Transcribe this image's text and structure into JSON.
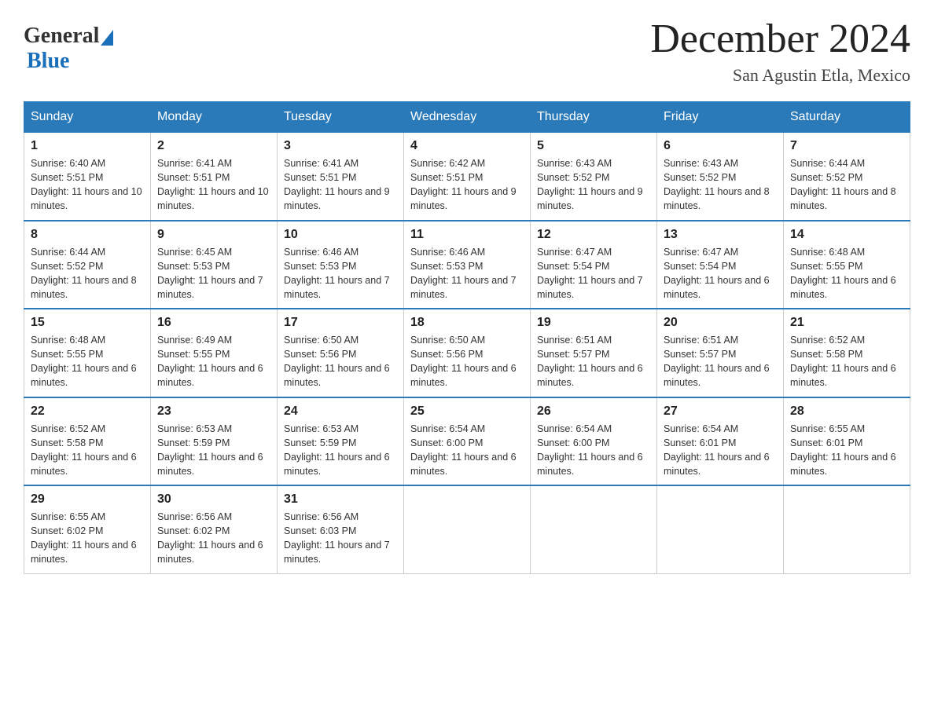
{
  "header": {
    "logo_general": "General",
    "logo_blue": "Blue",
    "month_title": "December 2024",
    "location": "San Agustin Etla, Mexico"
  },
  "days_of_week": [
    "Sunday",
    "Monday",
    "Tuesday",
    "Wednesday",
    "Thursday",
    "Friday",
    "Saturday"
  ],
  "weeks": [
    [
      {
        "day": "1",
        "sunrise": "6:40 AM",
        "sunset": "5:51 PM",
        "daylight": "11 hours and 10 minutes."
      },
      {
        "day": "2",
        "sunrise": "6:41 AM",
        "sunset": "5:51 PM",
        "daylight": "11 hours and 10 minutes."
      },
      {
        "day": "3",
        "sunrise": "6:41 AM",
        "sunset": "5:51 PM",
        "daylight": "11 hours and 9 minutes."
      },
      {
        "day": "4",
        "sunrise": "6:42 AM",
        "sunset": "5:51 PM",
        "daylight": "11 hours and 9 minutes."
      },
      {
        "day": "5",
        "sunrise": "6:43 AM",
        "sunset": "5:52 PM",
        "daylight": "11 hours and 9 minutes."
      },
      {
        "day": "6",
        "sunrise": "6:43 AM",
        "sunset": "5:52 PM",
        "daylight": "11 hours and 8 minutes."
      },
      {
        "day": "7",
        "sunrise": "6:44 AM",
        "sunset": "5:52 PM",
        "daylight": "11 hours and 8 minutes."
      }
    ],
    [
      {
        "day": "8",
        "sunrise": "6:44 AM",
        "sunset": "5:52 PM",
        "daylight": "11 hours and 8 minutes."
      },
      {
        "day": "9",
        "sunrise": "6:45 AM",
        "sunset": "5:53 PM",
        "daylight": "11 hours and 7 minutes."
      },
      {
        "day": "10",
        "sunrise": "6:46 AM",
        "sunset": "5:53 PM",
        "daylight": "11 hours and 7 minutes."
      },
      {
        "day": "11",
        "sunrise": "6:46 AM",
        "sunset": "5:53 PM",
        "daylight": "11 hours and 7 minutes."
      },
      {
        "day": "12",
        "sunrise": "6:47 AM",
        "sunset": "5:54 PM",
        "daylight": "11 hours and 7 minutes."
      },
      {
        "day": "13",
        "sunrise": "6:47 AM",
        "sunset": "5:54 PM",
        "daylight": "11 hours and 6 minutes."
      },
      {
        "day": "14",
        "sunrise": "6:48 AM",
        "sunset": "5:55 PM",
        "daylight": "11 hours and 6 minutes."
      }
    ],
    [
      {
        "day": "15",
        "sunrise": "6:48 AM",
        "sunset": "5:55 PM",
        "daylight": "11 hours and 6 minutes."
      },
      {
        "day": "16",
        "sunrise": "6:49 AM",
        "sunset": "5:55 PM",
        "daylight": "11 hours and 6 minutes."
      },
      {
        "day": "17",
        "sunrise": "6:50 AM",
        "sunset": "5:56 PM",
        "daylight": "11 hours and 6 minutes."
      },
      {
        "day": "18",
        "sunrise": "6:50 AM",
        "sunset": "5:56 PM",
        "daylight": "11 hours and 6 minutes."
      },
      {
        "day": "19",
        "sunrise": "6:51 AM",
        "sunset": "5:57 PM",
        "daylight": "11 hours and 6 minutes."
      },
      {
        "day": "20",
        "sunrise": "6:51 AM",
        "sunset": "5:57 PM",
        "daylight": "11 hours and 6 minutes."
      },
      {
        "day": "21",
        "sunrise": "6:52 AM",
        "sunset": "5:58 PM",
        "daylight": "11 hours and 6 minutes."
      }
    ],
    [
      {
        "day": "22",
        "sunrise": "6:52 AM",
        "sunset": "5:58 PM",
        "daylight": "11 hours and 6 minutes."
      },
      {
        "day": "23",
        "sunrise": "6:53 AM",
        "sunset": "5:59 PM",
        "daylight": "11 hours and 6 minutes."
      },
      {
        "day": "24",
        "sunrise": "6:53 AM",
        "sunset": "5:59 PM",
        "daylight": "11 hours and 6 minutes."
      },
      {
        "day": "25",
        "sunrise": "6:54 AM",
        "sunset": "6:00 PM",
        "daylight": "11 hours and 6 minutes."
      },
      {
        "day": "26",
        "sunrise": "6:54 AM",
        "sunset": "6:00 PM",
        "daylight": "11 hours and 6 minutes."
      },
      {
        "day": "27",
        "sunrise": "6:54 AM",
        "sunset": "6:01 PM",
        "daylight": "11 hours and 6 minutes."
      },
      {
        "day": "28",
        "sunrise": "6:55 AM",
        "sunset": "6:01 PM",
        "daylight": "11 hours and 6 minutes."
      }
    ],
    [
      {
        "day": "29",
        "sunrise": "6:55 AM",
        "sunset": "6:02 PM",
        "daylight": "11 hours and 6 minutes."
      },
      {
        "day": "30",
        "sunrise": "6:56 AM",
        "sunset": "6:02 PM",
        "daylight": "11 hours and 6 minutes."
      },
      {
        "day": "31",
        "sunrise": "6:56 AM",
        "sunset": "6:03 PM",
        "daylight": "11 hours and 7 minutes."
      },
      null,
      null,
      null,
      null
    ]
  ],
  "labels": {
    "sunrise_prefix": "Sunrise: ",
    "sunset_prefix": "Sunset: ",
    "daylight_prefix": "Daylight: "
  }
}
